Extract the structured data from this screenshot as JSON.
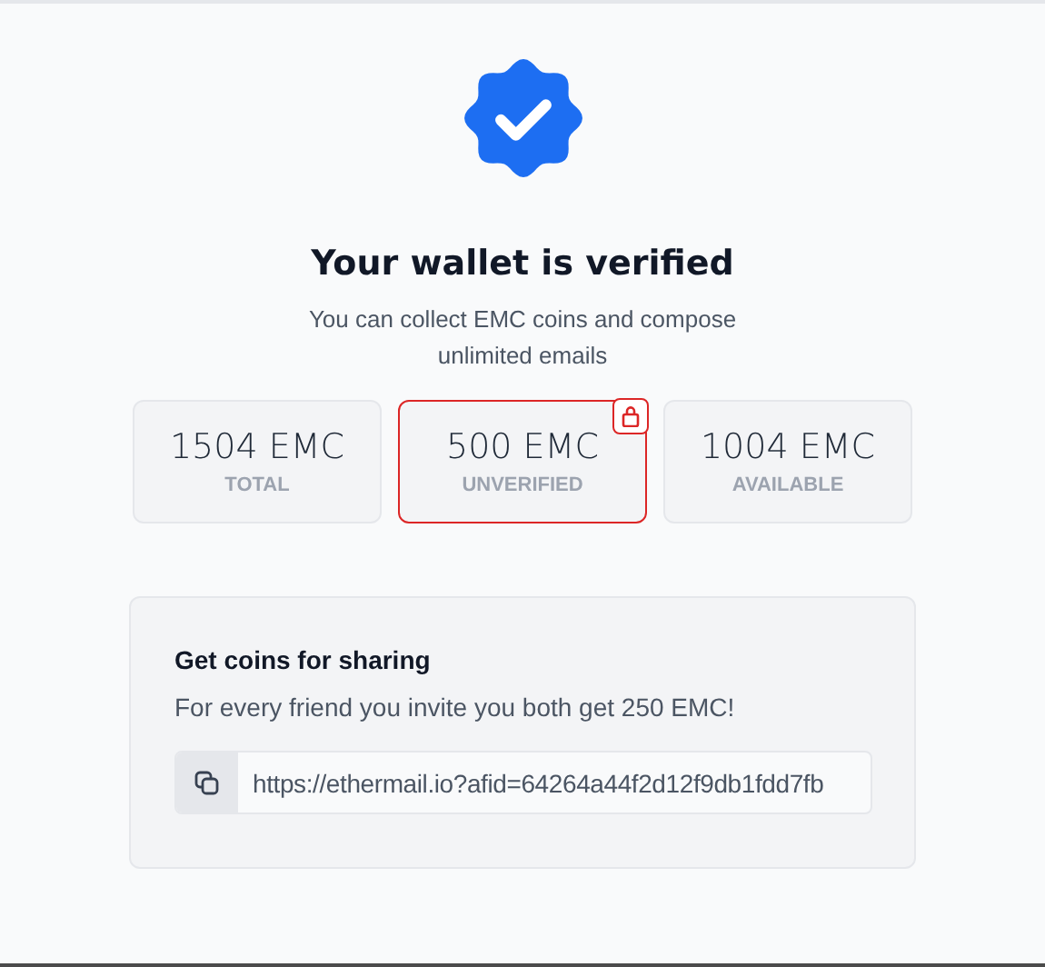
{
  "title": "Your wallet is verified",
  "subtitle": "You can collect EMC coins and compose unlimited emails",
  "stats": [
    {
      "amount": "1504 EMC",
      "label": "TOTAL",
      "locked": false
    },
    {
      "amount": "500 EMC",
      "label": "UNVERIFIED",
      "locked": true
    },
    {
      "amount": "1004 EMC",
      "label": "AVAILABLE",
      "locked": false
    }
  ],
  "share": {
    "title": "Get coins for sharing",
    "text": "For every friend you invite you both get 250 EMC!",
    "link": "https://ethermail.io?afid=64264a44f2d12f9db1fdd7fb"
  }
}
